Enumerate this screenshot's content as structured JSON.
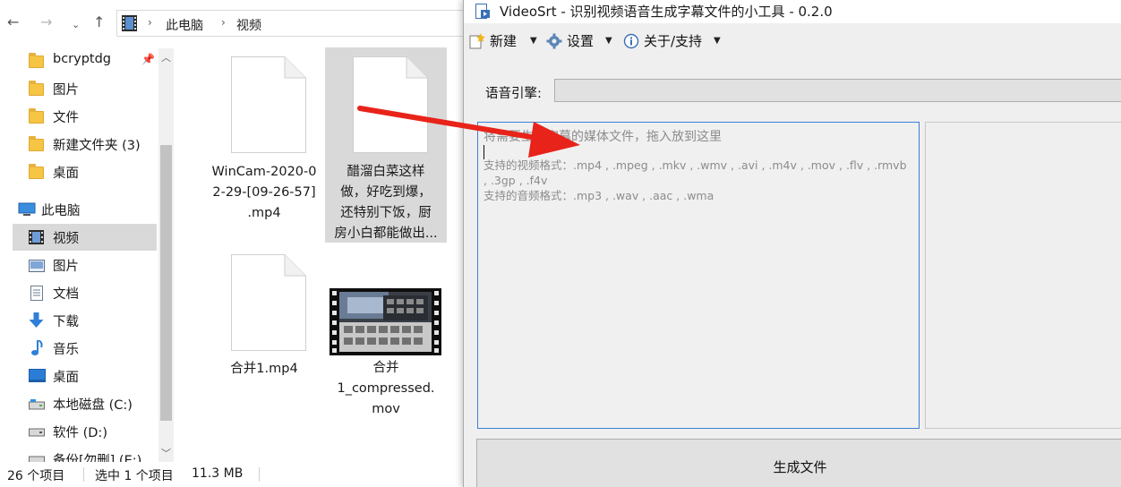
{
  "explorer": {
    "breadcrumb": [
      "此电脑",
      "视频"
    ],
    "nav": {
      "quick_access": [
        {
          "label": "bcryptdg",
          "icon": "folder-icon",
          "pinned": true
        },
        {
          "label": "图片",
          "icon": "folder-icon"
        },
        {
          "label": "文件",
          "icon": "folder-icon"
        },
        {
          "label": "新建文件夹 (3)",
          "icon": "folder-icon"
        },
        {
          "label": "桌面",
          "icon": "folder-icon"
        }
      ],
      "this_pc": "此电脑",
      "items": [
        {
          "label": "视频",
          "icon": "video-folder-icon",
          "selected": true
        },
        {
          "label": "图片",
          "icon": "pictures-folder-icon"
        },
        {
          "label": "文档",
          "icon": "documents-folder-icon"
        },
        {
          "label": "下载",
          "icon": "download-folder-icon"
        },
        {
          "label": "音乐",
          "icon": "music-folder-icon"
        },
        {
          "label": "桌面",
          "icon": "desktop-folder-icon"
        },
        {
          "label": "本地磁盘 (C:)",
          "icon": "drive-icon"
        },
        {
          "label": "软件 (D:)",
          "icon": "drive-icon"
        },
        {
          "label": "备份[勿删] (E:)",
          "icon": "drive-icon"
        }
      ]
    },
    "files": [
      {
        "name": "WinCam-2020-0\n2-29-[09-26-57]\n.mp4",
        "type": "document",
        "selected": false
      },
      {
        "name": "醋溜白菜这样\n做，好吃到爆，\n还特别下饭，厨\n房小白都能做出...",
        "type": "document",
        "selected": true
      },
      {
        "name": "合并1.mp4",
        "type": "document",
        "selected": false
      },
      {
        "name": "合并\n1_compressed.\nmov",
        "type": "video-thumbnail",
        "selected": false
      }
    ],
    "status": {
      "count": "26 个项目",
      "selected": "选中 1 个项目",
      "size": "11.3 MB"
    }
  },
  "app": {
    "title": "VideoSrt - 识别视频语音生成字幕文件的小工具 - 0.2.0",
    "menu": [
      {
        "label": "新建",
        "icon": "new-icon"
      },
      {
        "label": "设置",
        "icon": "gear-icon"
      },
      {
        "label": "关于/支持",
        "icon": "info-icon"
      }
    ],
    "engine_label": "语音引擎:",
    "engine_value": "",
    "dropzone": {
      "placeholder": "将需要生成字幕的媒体文件，拖入放到这里",
      "video_formats": "支持的视频格式：.mp4 , .mpeg , .mkv , .wmv , .avi , .m4v , .mov , .flv , .rmvb , .3gp , .f4v",
      "audio_formats": "支持的音频格式：.mp3 , .wav , .aac , .wma"
    },
    "generate_label": "生成文件"
  },
  "colors": {
    "accent_border": "#3c7fd6",
    "arrow": "#e8231a",
    "selection": "#d9d9d9"
  }
}
